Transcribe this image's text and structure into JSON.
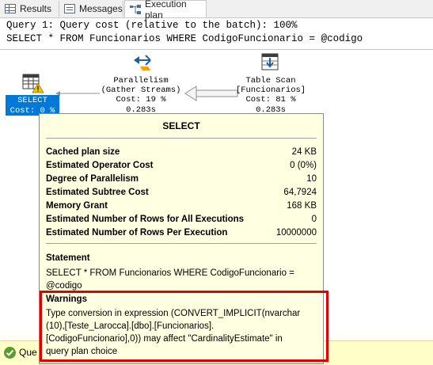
{
  "tabs": [
    {
      "label": "Results",
      "icon": "grid-icon"
    },
    {
      "label": "Messages",
      "icon": "messages-icon"
    },
    {
      "label": "Execution plan",
      "icon": "execution-plan-icon"
    }
  ],
  "query": {
    "header": "Query 1: Query cost (relative to the batch): 100%",
    "sql": "SELECT * FROM Funcionarios WHERE CodigoFuncionario = @codigo"
  },
  "plan": {
    "select_node": {
      "label": "SELECT",
      "cost": "Cost: 0 %"
    },
    "parallelism_node": {
      "line1": "Parallelism",
      "line2": "(Gather Streams)",
      "cost": "Cost: 19 %",
      "time": "0.283s"
    },
    "table_scan_node": {
      "line1": "Table Scan",
      "line2": "[Funcionarios]",
      "cost": "Cost: 81 %",
      "time": "0.283s"
    }
  },
  "tooltip": {
    "title": "SELECT",
    "rows": [
      {
        "key": "Cached plan size",
        "value": "24 KB"
      },
      {
        "key": "Estimated Operator Cost",
        "value": "0 (0%)"
      },
      {
        "key": "Degree of Parallelism",
        "value": "10"
      },
      {
        "key": "Estimated Subtree Cost",
        "value": "64,7924"
      },
      {
        "key": "Memory Grant",
        "value": "168 KB"
      },
      {
        "key": "Estimated Number of Rows for All Executions",
        "value": "0"
      },
      {
        "key": "Estimated Number of Rows Per Execution",
        "value": "10000000"
      }
    ],
    "statement_heading": "Statement",
    "statement_line1": "SELECT * FROM Funcionarios WHERE CodigoFuncionario =",
    "statement_line2": "@codigo",
    "warnings_heading": "Warnings",
    "warnings_line1": "Type conversion in expression (CONVERT_IMPLICIT(nvarchar",
    "warnings_line2": "(10),[Teste_Larocca].[dbo].[Funcionarios].",
    "warnings_line3": "[CodigoFuncionario],0)) may affect \"CardinalityEstimate\" in",
    "warnings_line4": "query plan choice"
  },
  "status_bar": {
    "text": "Que",
    "icon": "success-check-icon"
  },
  "colors": {
    "highlight_box": "#e00000",
    "tooltip_bg": "#ffffe1",
    "selected_node": "#0078d7",
    "status_bg": "#fffec8"
  }
}
